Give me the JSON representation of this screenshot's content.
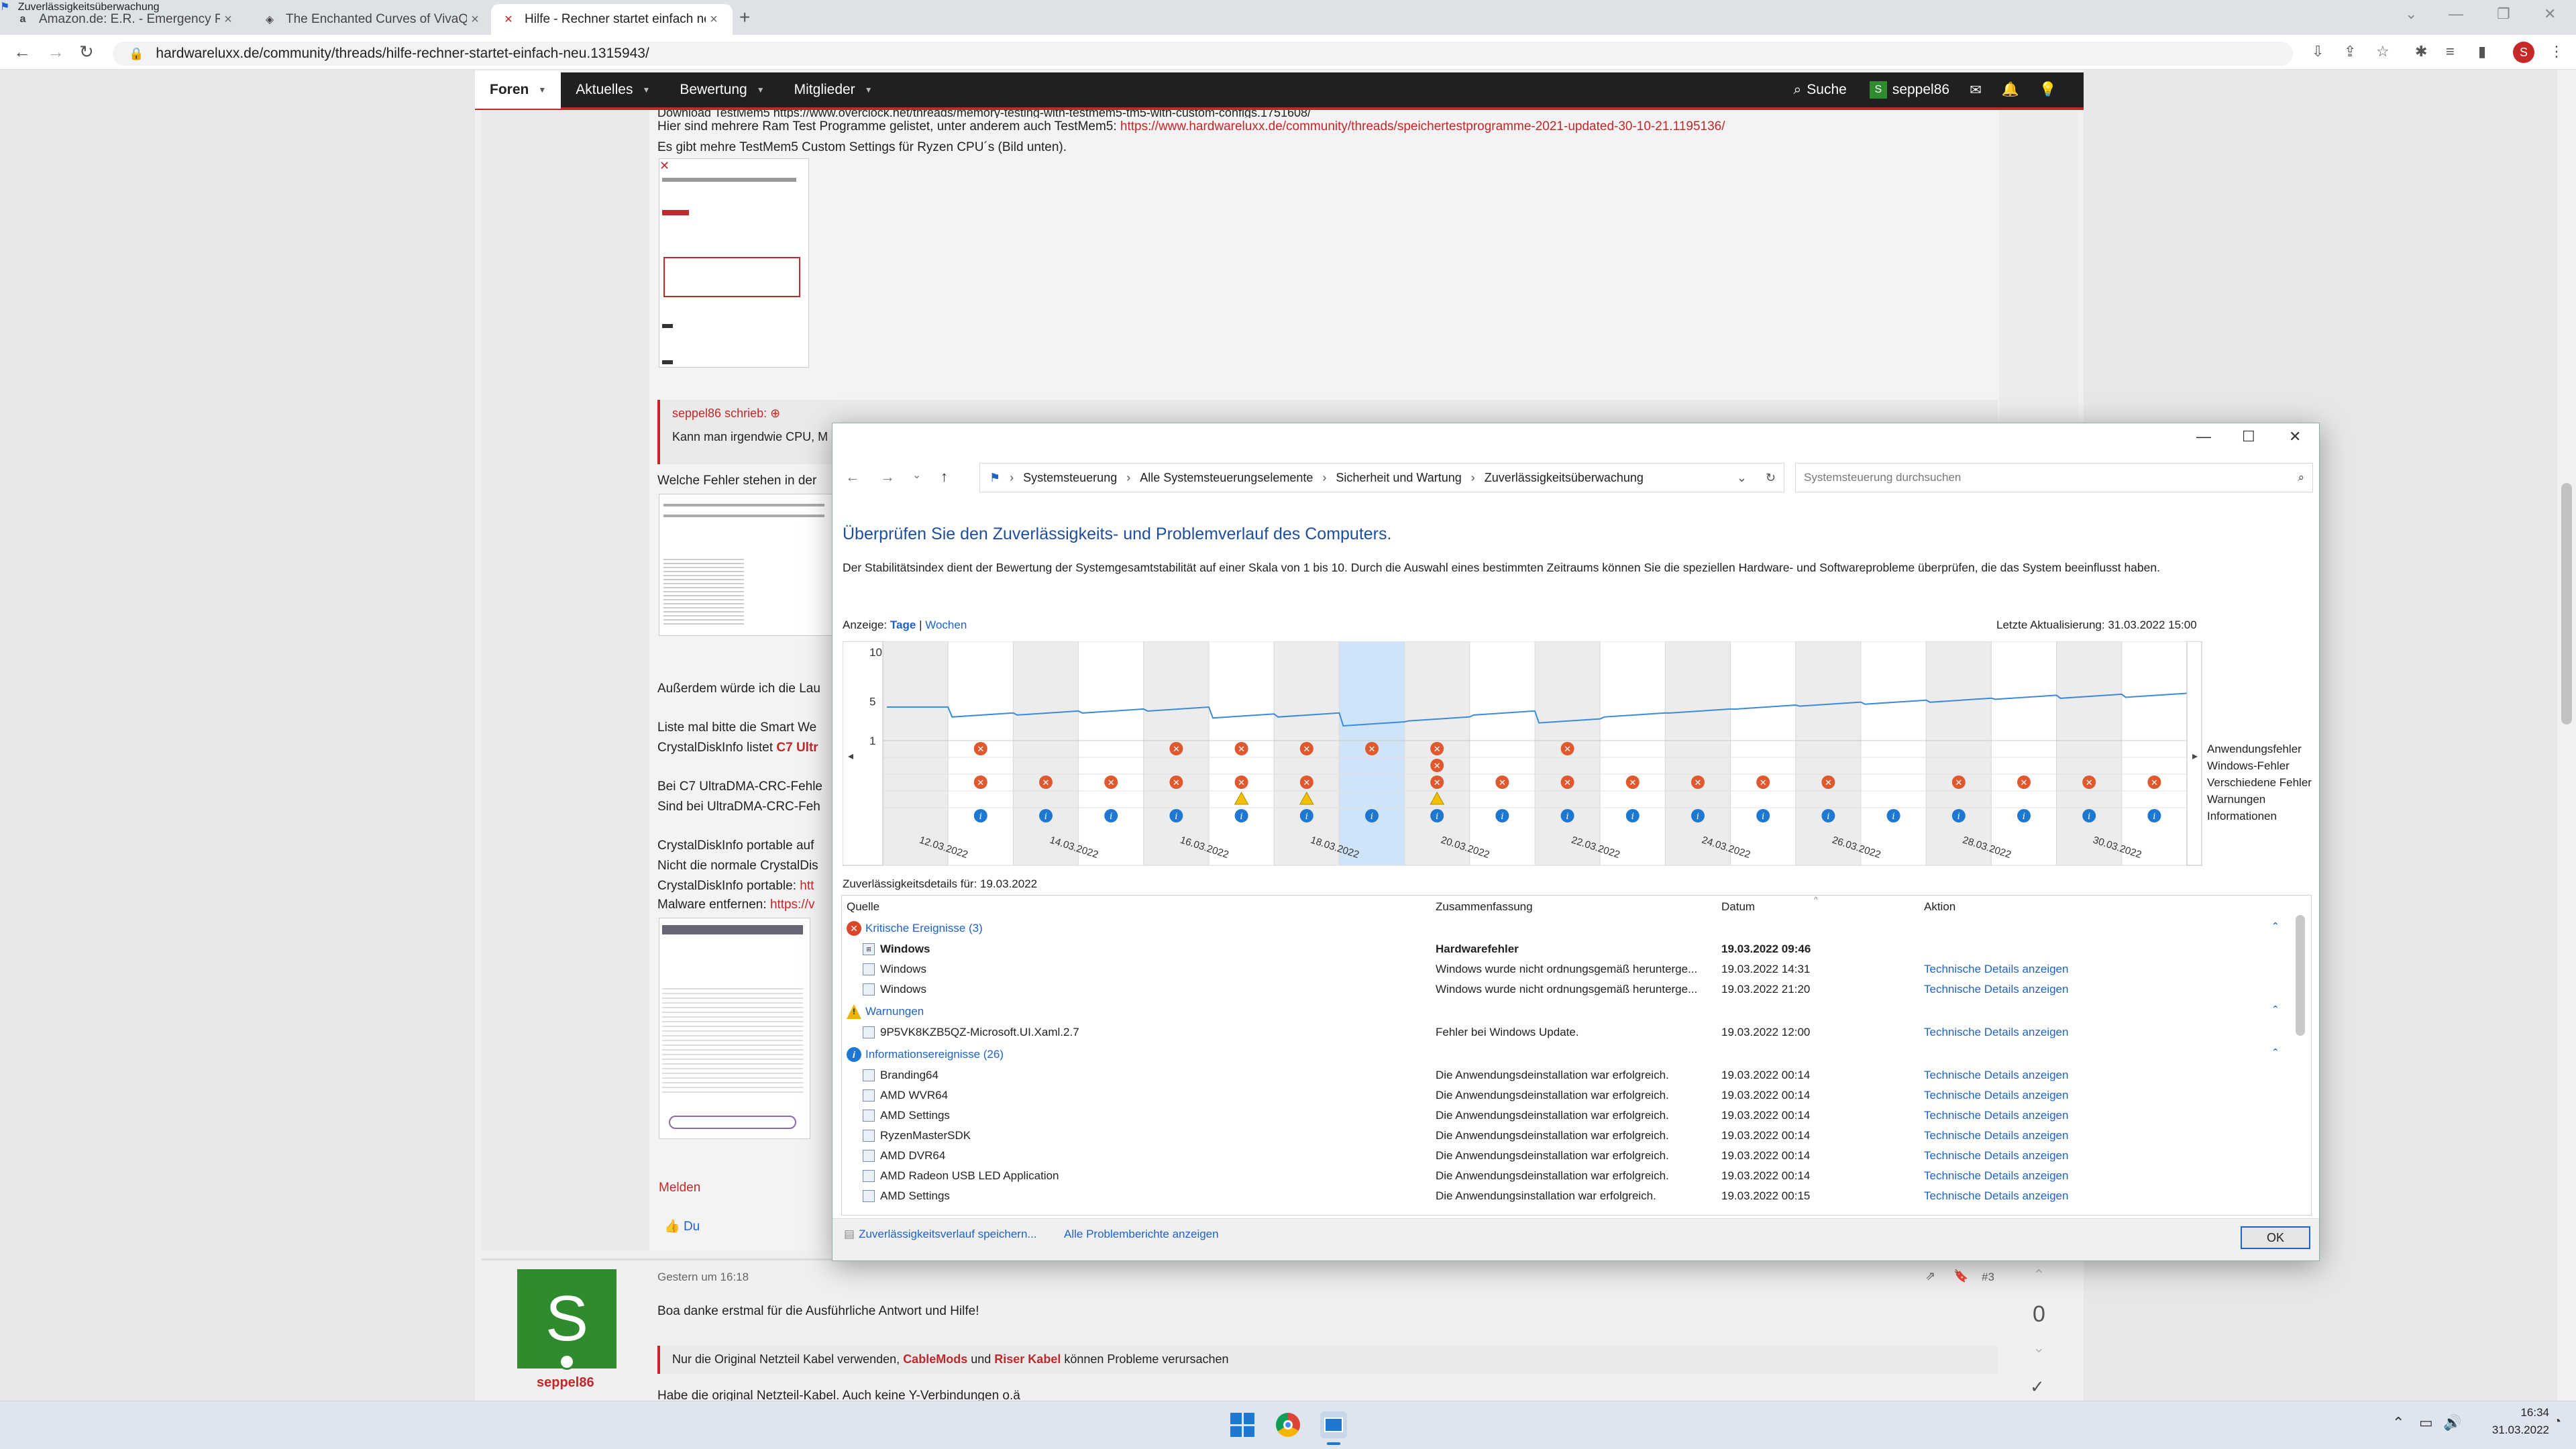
{
  "browser": {
    "tabs": [
      {
        "icon": "a",
        "title": "Amazon.de: E.R. - Emergency Ro"
      },
      {
        "icon": "◈",
        "title": "The Enchanted Curves of VivaQ"
      },
      {
        "icon": "✕",
        "title": "Hilfe - Rechner startet einfach ne"
      }
    ],
    "url": "hardwareluxx.de/community/threads/hilfe-rechner-startet-einfach-neu.1315943/"
  },
  "forum": {
    "nav": [
      {
        "label": "Foren"
      },
      {
        "label": "Aktuelles"
      },
      {
        "label": "Bewertung"
      },
      {
        "label": "Mitglieder"
      }
    ],
    "search_label": "Suche",
    "user_initial": "S",
    "username": "seppel86",
    "post1": {
      "line1_top": "Download TestMem5 https://www.overclock.net/threads/memory-testing-with-testmem5-tm5-with-custom-configs.1751608/",
      "line2_text": "Hier sind mehrere Ram Test Programme gelistet, unter anderem auch TestMem5:",
      "line2_link": "https://www.hardwareluxx.de/community/threads/speichertestprogramme-2021-updated-30-10-21.1195136/",
      "line3": "Es gibt mehre TestMem5 Custom Settings für Ryzen CPU´s (Bild unten).",
      "quote_author": "seppel86 schrieb:",
      "quote_text": "Kann man irgendwie CPU, M",
      "line_welche": "Welche Fehler stehen in der",
      "line_ausserdem": "Außerdem würde ich die Lau",
      "line_liste": "Liste mal bitte die Smart We",
      "line_crystal_a": "CrystalDiskInfo listet",
      "line_crystal_b": "C7 Ultr",
      "line_bei": "Bei C7 UltraDMA-CRC-Fehle",
      "line_sind": "Sind bei UltraDMA-CRC-Feh",
      "line_portable": "CrystalDiskInfo portable auf",
      "line_nicht": "Nicht die normale CrystalDis",
      "line_cdiport_a": "CrystalDiskInfo portable:",
      "line_cdiport_b": "htt",
      "line_malware_a": "Malware entfernen:",
      "line_malware_b": "https://v",
      "melden": "Melden",
      "like": "Du"
    },
    "post2": {
      "avatar_initial": "S",
      "username": "seppel86",
      "time": "Gestern um 16:18",
      "postnum": "#3",
      "votes": "0",
      "text": "Boa danke erstmal für die Ausführliche Antwort und Hilfe!",
      "sig_a": "Nur die Original Netzteil Kabel verwenden,",
      "sig_b": "CableMods",
      "sig_c": "und",
      "sig_d": "Riser Kabel",
      "sig_e": "können Probleme verursachen",
      "last": "Habe die original Netzteil-Kabel. Auch keine Y-Verbindungen o.ä"
    }
  },
  "dialog": {
    "title": "Zuverlässigkeitsüberwachung",
    "breadcrumb": [
      "Systemsteuerung",
      "Alle Systemsteuerungselemente",
      "Sicherheit und Wartung",
      "Zuverlässigkeitsüberwachung"
    ],
    "search_placeholder": "Systemsteuerung durchsuchen",
    "heading": "Überprüfen Sie den Zuverlässigkeits- und Problemverlauf des Computers.",
    "description": "Der Stabilitätsindex dient der Bewertung der Systemgesamtstabilität auf einer Skala von 1 bis 10. Durch die Auswahl eines bestimmten Zeitraums können Sie die speziellen Hardware- und Softwareprobleme überprüfen, die das System beeinflusst haben.",
    "view_label": "Anzeige:",
    "view_days": "Tage",
    "view_sep": "|",
    "view_weeks": "Wochen",
    "last_update": "Letzte Aktualisierung: 31.03.2022 15:00",
    "row_labels": [
      "Anwendungsfehler",
      "Windows-Fehler",
      "Verschiedene Fehler",
      "Warnungen",
      "Informationen"
    ],
    "details_for": "Zuverlässigkeitsdetails für: 19.03.2022",
    "columns": [
      "Quelle",
      "Zusammenfassung",
      "Datum",
      "Aktion"
    ],
    "groups": {
      "critical": "Kritische Ereignisse (3)",
      "warnings": "Warnungen",
      "info": "Informationsereignisse (26)"
    },
    "critical_rows": [
      {
        "source": "Windows",
        "summary": "Hardwarefehler",
        "date": "19.03.2022 09:46",
        "action": ""
      },
      {
        "source": "Windows",
        "summary": "Windows wurde nicht ordnungsgemäß herunterge...",
        "date": "19.03.2022 14:31",
        "action": "Technische Details anzeigen"
      },
      {
        "source": "Windows",
        "summary": "Windows wurde nicht ordnungsgemäß herunterge...",
        "date": "19.03.2022 21:20",
        "action": "Technische Details anzeigen"
      }
    ],
    "warning_rows": [
      {
        "source": "9P5VK8KZB5QZ-Microsoft.UI.Xaml.2.7",
        "summary": "Fehler bei Windows Update.",
        "date": "19.03.2022 12:00",
        "action": "Technische Details anzeigen"
      }
    ],
    "info_rows": [
      {
        "source": "Branding64",
        "summary": "Die Anwendungsdeinstallation war erfolgreich.",
        "date": "19.03.2022 00:14",
        "action": "Technische Details anzeigen"
      },
      {
        "source": "AMD WVR64",
        "summary": "Die Anwendungsdeinstallation war erfolgreich.",
        "date": "19.03.2022 00:14",
        "action": "Technische Details anzeigen"
      },
      {
        "source": "AMD Settings",
        "summary": "Die Anwendungsdeinstallation war erfolgreich.",
        "date": "19.03.2022 00:14",
        "action": "Technische Details anzeigen"
      },
      {
        "source": "RyzenMasterSDK",
        "summary": "Die Anwendungsdeinstallation war erfolgreich.",
        "date": "19.03.2022 00:14",
        "action": "Technische Details anzeigen"
      },
      {
        "source": "AMD DVR64",
        "summary": "Die Anwendungsdeinstallation war erfolgreich.",
        "date": "19.03.2022 00:14",
        "action": "Technische Details anzeigen"
      },
      {
        "source": "AMD Radeon USB LED Application",
        "summary": "Die Anwendungsdeinstallation war erfolgreich.",
        "date": "19.03.2022 00:14",
        "action": "Technische Details anzeigen"
      },
      {
        "source": "AMD Settings",
        "summary": "Die Anwendungsinstallation war erfolgreich.",
        "date": "19.03.2022 00:15",
        "action": "Technische Details anzeigen"
      }
    ],
    "footer_save": "Zuverlässigkeitsverlauf speichern...",
    "footer_reports": "Alle Problemberichte anzeigen",
    "ok": "OK"
  },
  "chart_data": {
    "type": "line",
    "title": "",
    "y_ticks": [
      "10",
      "5",
      "1"
    ],
    "ylim": [
      1,
      10
    ],
    "x_labels": [
      "12.03.2022",
      "14.03.2022",
      "16.03.2022",
      "18.03.2022",
      "20.03.2022",
      "22.03.2022",
      "24.03.2022",
      "26.03.2022",
      "28.03.2022",
      "30.03.2022"
    ],
    "days": 20,
    "selected_index": 7,
    "stability_index": [
      4.0,
      3.4,
      3.6,
      3.8,
      4.0,
      3.3,
      3.4,
      2.5,
      3.0,
      3.6,
      2.8,
      3.4,
      3.8,
      4.2,
      4.5,
      4.7,
      4.9,
      5.2,
      5.3,
      5.4
    ],
    "events": {
      "app_errors": [
        0,
        1,
        0,
        0,
        1,
        1,
        1,
        1,
        1,
        0,
        1,
        0,
        0,
        0,
        0,
        0,
        0,
        0,
        0,
        0
      ],
      "win_errors": [
        0,
        0,
        0,
        0,
        0,
        0,
        0,
        0,
        1,
        0,
        0,
        0,
        0,
        0,
        0,
        0,
        0,
        0,
        0,
        0
      ],
      "misc_errors": [
        0,
        1,
        1,
        1,
        1,
        1,
        1,
        0,
        1,
        1,
        1,
        1,
        1,
        1,
        1,
        0,
        1,
        1,
        1,
        1
      ],
      "warnings": [
        0,
        0,
        0,
        0,
        0,
        1,
        1,
        0,
        1,
        0,
        0,
        0,
        0,
        0,
        0,
        0,
        0,
        0,
        0,
        0
      ],
      "info": [
        0,
        1,
        1,
        1,
        1,
        1,
        1,
        1,
        1,
        1,
        1,
        1,
        1,
        1,
        1,
        1,
        1,
        1,
        1,
        1
      ]
    }
  },
  "taskbar": {
    "time": "16:34",
    "date": "31.03.2022"
  }
}
